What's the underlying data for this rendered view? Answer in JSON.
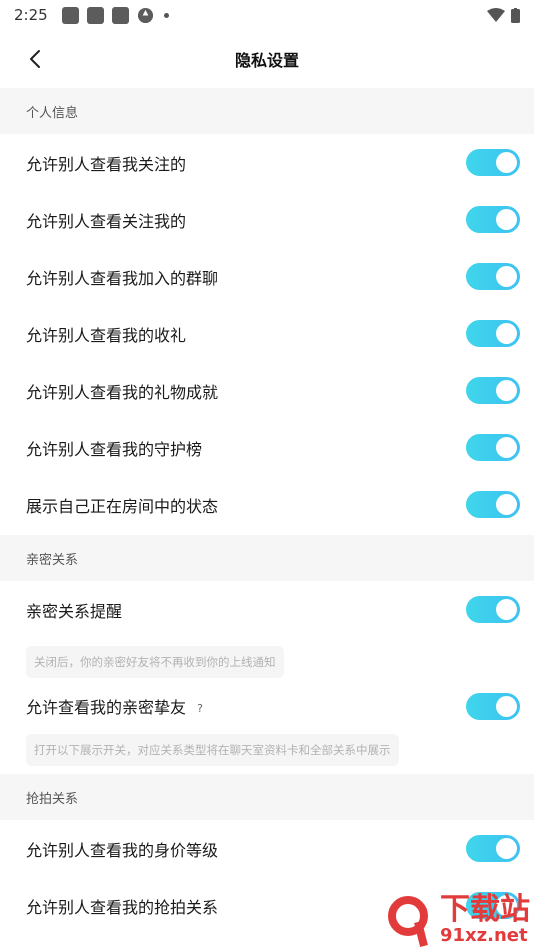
{
  "status_bar": {
    "time": "2:25"
  },
  "nav": {
    "title": "隐私设置"
  },
  "sections": [
    {
      "header": "个人信息",
      "items": [
        {
          "label": "允许别人查看我关注的",
          "enabled": true
        },
        {
          "label": "允许别人查看关注我的",
          "enabled": true
        },
        {
          "label": "允许别人查看我加入的群聊",
          "enabled": true
        },
        {
          "label": "允许别人查看我的收礼",
          "enabled": true
        },
        {
          "label": "允许别人查看我的礼物成就",
          "enabled": true
        },
        {
          "label": "允许别人查看我的守护榜",
          "enabled": true
        },
        {
          "label": "展示自己正在房间中的状态",
          "enabled": true
        }
      ]
    },
    {
      "header": "亲密关系",
      "items": [
        {
          "label": "亲密关系提醒",
          "enabled": true,
          "hint": "关闭后，你的亲密好友将不再收到你的上线通知"
        },
        {
          "label": "允许查看我的亲密挚友",
          "help": "?",
          "enabled": true,
          "hint": "打开以下展示开关，对应关系类型将在聊天室资料卡和全部关系中展示"
        }
      ]
    },
    {
      "header": "抢拍关系",
      "items": [
        {
          "label": "允许别人查看我的身价等级",
          "enabled": true
        },
        {
          "label": "允许别人查看我的抢拍关系",
          "enabled": true
        }
      ]
    }
  ],
  "watermark": {
    "main": "下载站",
    "sub": "91xz.net"
  },
  "colors": {
    "toggle_on": "#3fd6ea",
    "section_bg": "#f6f6f7"
  }
}
